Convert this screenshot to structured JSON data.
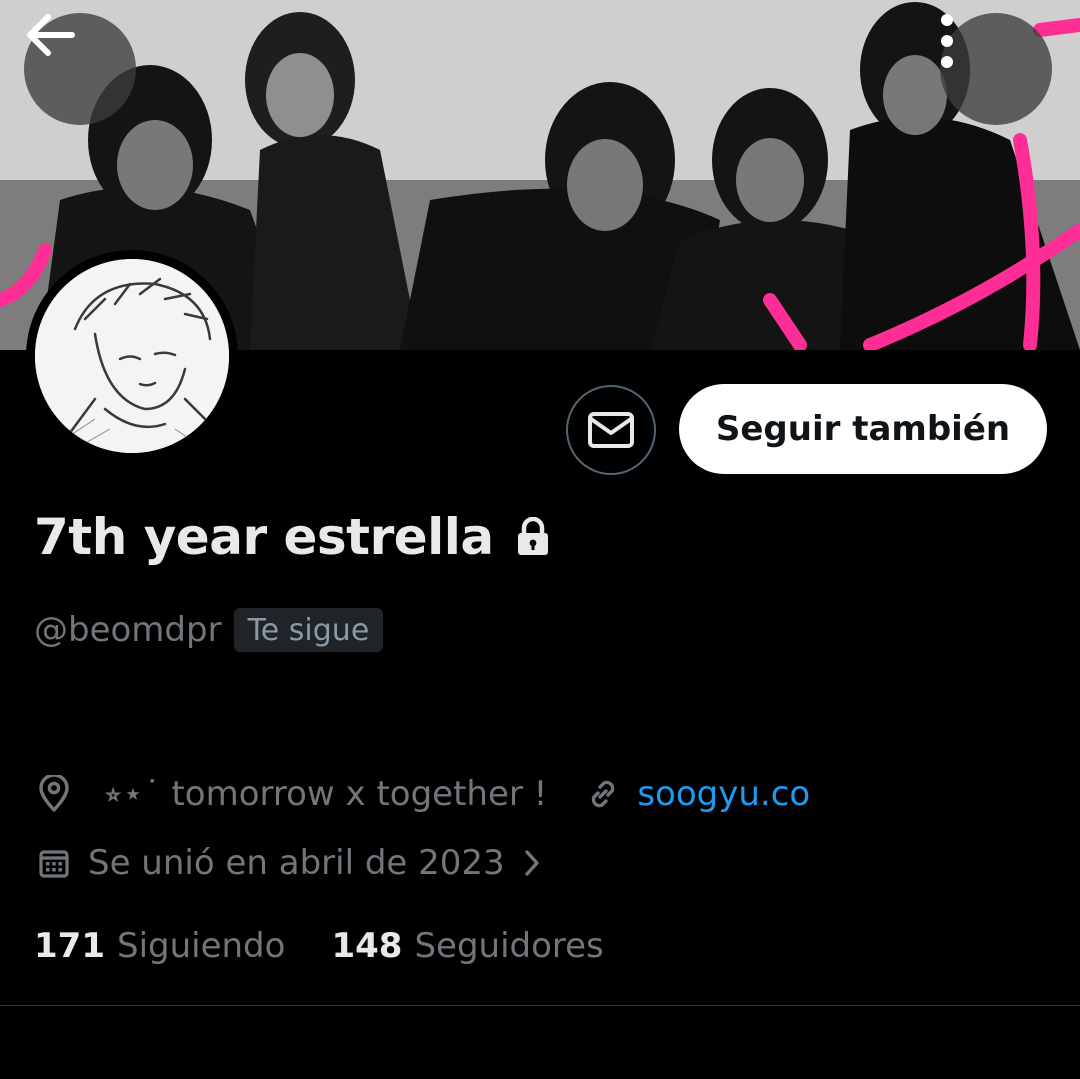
{
  "header": {
    "back_icon": "arrow-left-icon",
    "more_icon": "more-vertical-icon",
    "banner_accent": "#ff2d96"
  },
  "profile": {
    "display_name": "7th year estrella",
    "protected_icon": "lock-icon",
    "handle": "@beomdpr",
    "follows_you_badge": "Te sigue",
    "location_icon": "location-pin-icon",
    "location": "⭒⋆˙ tomorrow x together !",
    "link_icon": "link-icon",
    "website": "soogyu.co",
    "joined_icon": "calendar-icon",
    "joined": "Se unió en abril de 2023"
  },
  "actions": {
    "message_icon": "envelope-icon",
    "follow_label": "Seguir también"
  },
  "stats": {
    "following_count": "171",
    "following_label": "Siguiendo",
    "followers_count": "148",
    "followers_label": "Seguidores"
  },
  "colors": {
    "background": "#000000",
    "link": "#1d9bf0",
    "secondary_text": "#71767b",
    "primary_text": "#e7e9ea"
  }
}
